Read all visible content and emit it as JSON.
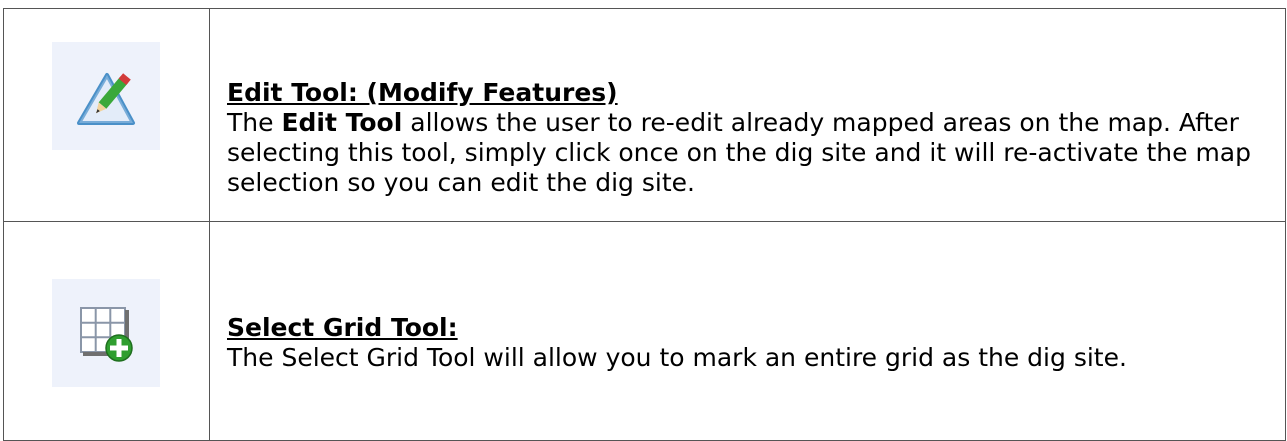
{
  "rows": [
    {
      "icon": "edit-tool-icon",
      "heading": "Edit Tool: (Modify Features)",
      "body": {
        "bold_term": "Edit Tool",
        "rest": " allows the user to re-edit already mapped areas on the map.  After selecting this tool, simply click once on the dig site and it will re-activate the map selection so you can edit the dig site.",
        "lead": "The "
      }
    },
    {
      "icon": "select-grid-tool-icon",
      "heading": "Select Grid Tool:",
      "body": {
        "text": "The Select Grid Tool will allow you to mark an entire grid as the dig site."
      }
    }
  ],
  "colors": {
    "icon_background": "#eef2fb",
    "border": "#555555",
    "triangle_blue": "#4a90c8",
    "pencil_green": "#3aa83a",
    "pencil_red": "#d23a3a",
    "grid_plus_green": "#2f9e2f"
  }
}
